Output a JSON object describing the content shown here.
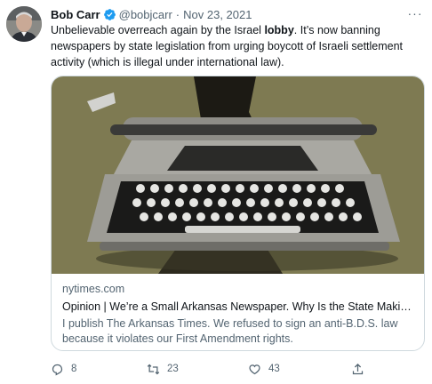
{
  "tweet": {
    "display_name": "Bob Carr",
    "handle": "@bobjcarr",
    "separator": "·",
    "date": "Nov 23, 2021",
    "more_label": "···",
    "text_before": "Unbelievable overreach again by the Israel ",
    "text_bold": "lobby",
    "text_after": ". It’s now banning newspapers by state legislation from urging boycott of Israeli settlement activity (which is illegal under international law)."
  },
  "card": {
    "domain": "nytimes.com",
    "title": "Opinion | We’re a Small Arkansas Newspaper. Why Is the State Makin…",
    "description": "I publish The Arkansas Times. We refused to sign an anti-B.D.S. law because it violates our First Amendment rights.",
    "image_subject": "typewriter"
  },
  "actions": {
    "reply_count": "8",
    "retweet_count": "23",
    "like_count": "43"
  },
  "colors": {
    "verified": "#1d9bf0",
    "secondary_text": "#536471",
    "image_background": "#7e7a52"
  },
  "icons": [
    "verified-badge-icon",
    "more-icon",
    "reply-icon",
    "retweet-icon",
    "like-icon",
    "share-icon"
  ]
}
